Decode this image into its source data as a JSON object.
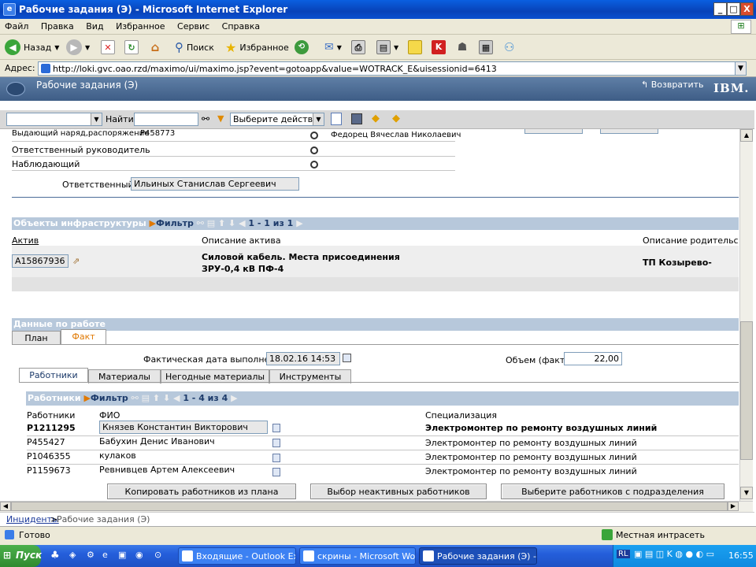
{
  "window": {
    "title": "Рабочие задания (Э) - Microsoft Internet Explorer",
    "min": "_",
    "max": "□",
    "close": "X"
  },
  "menu": [
    "Файл",
    "Правка",
    "Вид",
    "Избранное",
    "Сервис",
    "Справка"
  ],
  "toolbar": {
    "back": "Назад",
    "search": "Поиск",
    "favorites": "Избранное"
  },
  "address": {
    "label": "Адрес:",
    "url": "http://loki.gvc.oao.rzd/maximo/ui/maximo.jsp?event=gotoapp&value=WOTRACK_E&uisessionid=6413"
  },
  "app": {
    "title": "Рабочие задания (Э)",
    "return_label": "Возвратить",
    "brand": "IBM."
  },
  "mxtoolbar": {
    "find_label": "Найти:",
    "action_placeholder": "Выберите действие"
  },
  "header_fields": {
    "issuer_label": "Выдающий наряд,распоряжение",
    "issuer_code": "P458773",
    "issuer_name": "Федорец Вячеслав Николаевич",
    "manager_label": "Ответственный руководитель",
    "observer_label": "Наблюдающий",
    "responsible_label": "Ответственный",
    "responsible_value": "Ильиных Станислав Сергеевич",
    "number_label": ""
  },
  "assets": {
    "title": "Объекты инфраструктуры",
    "filter": "Фильтр",
    "paging": "1 - 1 из 1",
    "columns": [
      "Актив",
      "Описание актива",
      "Описание родительского с"
    ],
    "row": {
      "asset": "A15867936",
      "desc_line1": "Силовой кабель. Места присоединения",
      "desc_line2": "ЗРУ-0,4 кВ ПФ-4",
      "parent": "ТП Козырево-"
    }
  },
  "work": {
    "title": "Данные по работе",
    "tabs": [
      "План",
      "Факт"
    ],
    "actual_date_label": "Фактическая дата выполнения",
    "actual_date": "18.02.16 14:53",
    "volume_label": "Объем (факт)",
    "volume": "22,00",
    "subtabs": [
      "Работники",
      "Материалы",
      "Негодные материалы",
      "Инструменты"
    ]
  },
  "workers": {
    "title": "Работники",
    "filter": "Фильтр",
    "paging": "1 - 4 из 4",
    "columns": [
      "Работники",
      "ФИО",
      "Специализация"
    ],
    "rows": [
      {
        "id": "P1211295",
        "name": "Князев Константин Викторович",
        "spec": "Электромонтер по ремонту воздушных линий"
      },
      {
        "id": "P455427",
        "name": "Бабухин Денис Иванович",
        "spec": "Электромонтер по ремонту воздушных линий"
      },
      {
        "id": "P1046355",
        "name": "кулаков",
        "spec": "Электромонтер по ремонту воздушных линий"
      },
      {
        "id": "P1159673",
        "name": "Ревнивцев Артем Алексеевич",
        "spec": "Электромонтер по ремонту воздушных линий"
      }
    ],
    "buttons": [
      "Копировать работников из плана",
      "Выбор неактивных работников",
      "Выберите работников с подразделения"
    ]
  },
  "breadcrumb": {
    "link": "Инциденты",
    "sep": ">",
    "current": "Рабочие задания (Э)"
  },
  "status": {
    "done": "Готово",
    "zone": "Местная интрасеть"
  },
  "taskbar": {
    "start": "Пуск",
    "tasks": [
      "Входящие - Outlook Exp...",
      "скрины - Microsoft Word",
      "Рабочие задания (Э) -..."
    ],
    "lang": "RL",
    "clock": "16:55"
  }
}
